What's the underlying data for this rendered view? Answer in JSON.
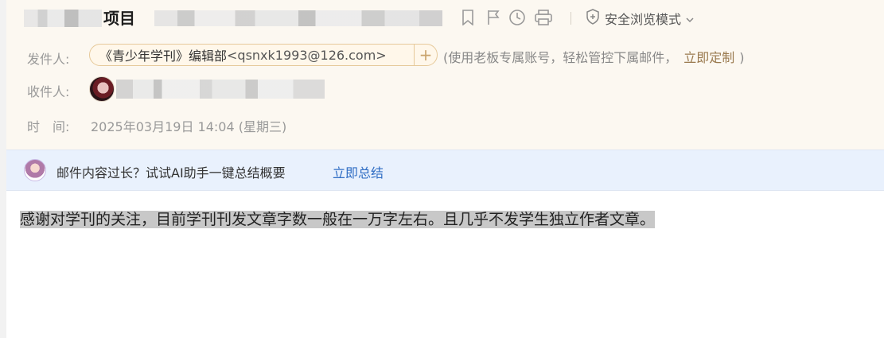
{
  "subject": {
    "text": "项目"
  },
  "toolbar": {
    "icons": [
      "bookmark-icon",
      "flag-icon",
      "clock-icon",
      "print-icon"
    ],
    "safe_mode_label": "安全浏览模式",
    "safe_mode_icon": "shield-icon"
  },
  "sender": {
    "label": "发件人:",
    "name": "《青少年学刊》编辑部",
    "email": "<qsnxk1993@126.com>",
    "add_symbol": "+",
    "note": "(使用老板专属账号，轻松管控下属邮件，",
    "note_link": "立即定制",
    "note_close": ")"
  },
  "recipient": {
    "label": "收件人:"
  },
  "time": {
    "label": "时　间:",
    "value": "2025年03月19日 14:04 (星期三)"
  },
  "ai_banner": {
    "text": "邮件内容过长？试试AI助手一键总结概要",
    "link": "立即总结"
  },
  "body": {
    "text": "感谢对学刊的关注，目前学刊刊发文章字数一般在一万字左右。且几乎不发学生独立作者文章。"
  },
  "colors": {
    "header_bg": "#fcf8f1",
    "ai_bar_bg": "#e9f1fd",
    "link": "#2f6dc4",
    "highlight": "#c8c8c8"
  }
}
